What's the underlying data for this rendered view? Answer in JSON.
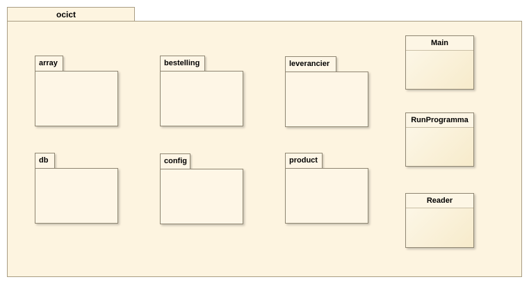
{
  "diagram": {
    "container": {
      "name": "ocict"
    },
    "packages": [
      "array",
      "bestelling",
      "leverancier",
      "db",
      "config",
      "product"
    ],
    "classes": [
      "Main",
      "RunProgramma",
      "Reader"
    ]
  }
}
